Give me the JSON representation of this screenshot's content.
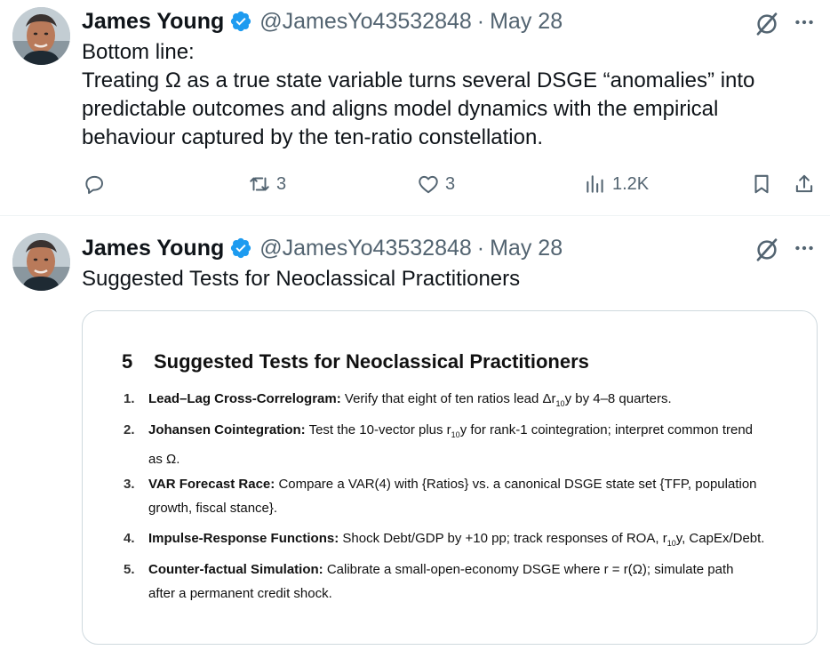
{
  "tweets": [
    {
      "author": "James Young",
      "handle": "@JamesYo43532848",
      "separator": "·",
      "date": "May 28",
      "lines": [
        "Bottom line:",
        "Treating Ω as a true state variable turns several DSGE “anomalies” into",
        "predictable outcomes and aligns model dynamics with the empirical",
        "behaviour captured by the ten-ratio constellation."
      ],
      "actions": {
        "reposts": "3",
        "likes": "3",
        "views": "1.2K"
      }
    },
    {
      "author": "James Young",
      "handle": "@JamesYo43532848",
      "separator": "·",
      "date": "May 28",
      "text": "Suggested Tests for Neoclassical Practitioners",
      "card": {
        "section_number": "5",
        "section_title": "Suggested Tests for Neoclassical Practitioners",
        "items": [
          {
            "num": "1.",
            "title": "Lead–Lag Cross-Correlogram:",
            "text_pre": "Verify that eight of ten ratios lead Δr",
            "sub": "10",
            "text_post": "y by 4–8 quarters.",
            "cont": ""
          },
          {
            "num": "2.",
            "title": "Johansen Cointegration:",
            "text_pre": "Test the 10-vector plus r",
            "sub": "10",
            "text_post": "y for rank-1 cointegration; interpret common trend",
            "cont": "as Ω."
          },
          {
            "num": "3.",
            "title": "VAR Forecast Race:",
            "text_pre": "Compare a VAR(4) with {Ratios} vs. a canonical DSGE state set {TFP, population",
            "sub": "",
            "text_post": "",
            "cont": "growth, fiscal stance}."
          },
          {
            "num": "4.",
            "title": "Impulse-Response Functions:",
            "text_pre": "Shock Debt/GDP by +10 pp; track responses of ROA, r",
            "sub": "10",
            "text_post": "y, CapEx/Debt.",
            "cont": ""
          },
          {
            "num": "5.",
            "title": "Counter-factual Simulation:",
            "text_pre": "Calibrate a small-open-economy DSGE where r = r(Ω); simulate path",
            "sub": "",
            "text_post": "",
            "cont": "after a permanent credit shock."
          }
        ]
      }
    }
  ],
  "colors": {
    "verified": "#1d9bf0",
    "muted": "#536471",
    "text": "#0f1419",
    "border": "#cfd9de"
  },
  "icons": [
    "verified-badge-icon",
    "grok-icon",
    "more-icon",
    "reply-icon",
    "repost-icon",
    "like-icon",
    "views-icon",
    "bookmark-icon",
    "share-icon"
  ]
}
